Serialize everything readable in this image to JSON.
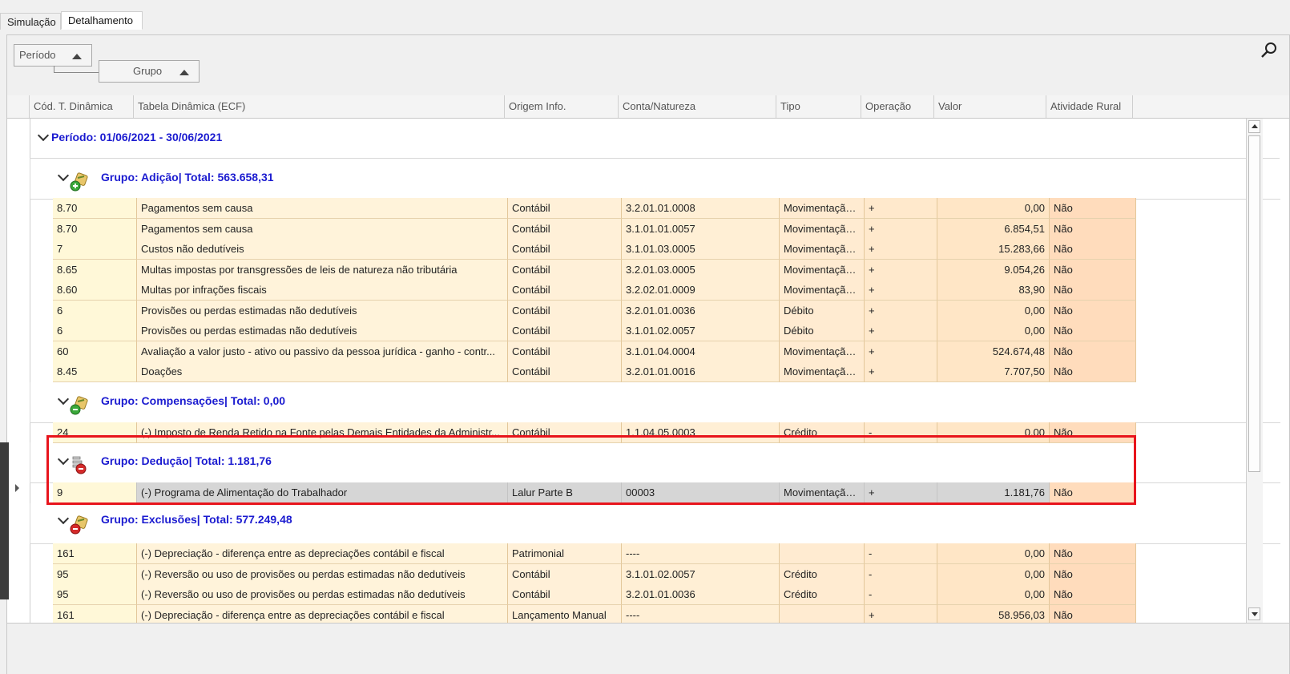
{
  "tabs": [
    {
      "label": "Simulação"
    },
    {
      "label": "Detalhamento"
    }
  ],
  "group_panel": {
    "level1": "Período",
    "level2": "Grupo"
  },
  "columns": [
    "Cód. T. Dinâmica",
    "Tabela Dinâmica (ECF)",
    "Origem Info.",
    "Conta/Natureza",
    "Tipo",
    "Operação",
    "Valor",
    "Atividade Rural"
  ],
  "period": {
    "caption": "Período: 01/06/2021 - 30/06/2021"
  },
  "groups": [
    {
      "caption": "Grupo: Adição| Total: 563.658,31",
      "icon": "add-group-icon",
      "rows": [
        [
          "8.70",
          "Pagamentos sem causa",
          "Contábil",
          "3.2.01.01.0008",
          "Movimentação...",
          "+",
          "0,00",
          "Não"
        ],
        [
          "8.70",
          "Pagamentos sem causa",
          "Contábil",
          "3.1.01.01.0057",
          "Movimentação...",
          "+",
          "6.854,51",
          "Não"
        ],
        [
          "7",
          "Custos não dedutíveis",
          "Contábil",
          "3.1.01.03.0005",
          "Movimentação...",
          "+",
          "15.283,66",
          "Não"
        ],
        [
          "8.65",
          "Multas impostas por transgressões de leis de natureza não tributária",
          "Contábil",
          "3.2.01.03.0005",
          "Movimentação...",
          "+",
          "9.054,26",
          "Não"
        ],
        [
          "8.60",
          "Multas por infrações fiscais",
          "Contábil",
          "3.2.02.01.0009",
          "Movimentação...",
          "+",
          "83,90",
          "Não"
        ],
        [
          "6",
          "Provisões ou perdas estimadas não dedutíveis",
          "Contábil",
          "3.2.01.01.0036",
          "Débito",
          "+",
          "0,00",
          "Não"
        ],
        [
          "6",
          "Provisões ou perdas estimadas não dedutíveis",
          "Contábil",
          "3.1.01.02.0057",
          "Débito",
          "+",
          "0,00",
          "Não"
        ],
        [
          "60",
          "Avaliação a valor justo - ativo ou passivo da pessoa jurídica - ganho - contr...",
          "Contábil",
          "3.1.01.04.0004",
          "Movimentação...",
          "+",
          "524.674,48",
          "Não"
        ],
        [
          "8.45",
          "Doações",
          "Contábil",
          "3.2.01.01.0016",
          "Movimentação...",
          "+",
          "7.707,50",
          "Não"
        ]
      ]
    },
    {
      "caption": "Grupo: Compensações| Total: 0,00",
      "icon": "compensation-group-icon",
      "rows": [
        [
          "24",
          "(-) Imposto de Renda Retido na Fonte pelas Demais Entidades da Administr...",
          "Contábil",
          "1.1.04.05.0003",
          "Crédito",
          "-",
          "0,00",
          "Não"
        ]
      ]
    },
    {
      "caption": "Grupo: Dedução| Total: 1.181,76",
      "icon": "deduction-group-icon",
      "rows": [
        [
          "9",
          "(-) Programa de Alimentação do Trabalhador",
          "Lalur Parte B",
          "00003",
          "Movimentação...",
          "+",
          "1.181,76",
          "Não"
        ]
      ]
    },
    {
      "caption": "Grupo: Exclusões| Total: 577.249,48",
      "icon": "exclusion-group-icon",
      "rows": [
        [
          "161",
          "(-) Depreciação - diferença entre as depreciações contábil e fiscal",
          "Patrimonial",
          "----",
          "",
          "-",
          "0,00",
          "Não"
        ],
        [
          "95",
          "(-) Reversão ou uso de provisões ou perdas estimadas não dedutíveis",
          "Contábil",
          "3.1.01.02.0057",
          "Crédito",
          "-",
          "0,00",
          "Não"
        ],
        [
          "95",
          "(-) Reversão ou uso de provisões ou perdas estimadas não dedutíveis",
          "Contábil",
          "3.2.01.01.0036",
          "Crédito",
          "-",
          "0,00",
          "Não"
        ],
        [
          "161",
          "(-) Depreciação - diferença entre as depreciações contábil e fiscal",
          "Lançamento Manual",
          "----",
          "",
          "+",
          "58.956,03",
          "Não"
        ]
      ]
    }
  ],
  "colors": {
    "caption_blue": "#1b1bd0",
    "highlight_red": "#e8141c",
    "selected_row": "#d6d6d6"
  }
}
